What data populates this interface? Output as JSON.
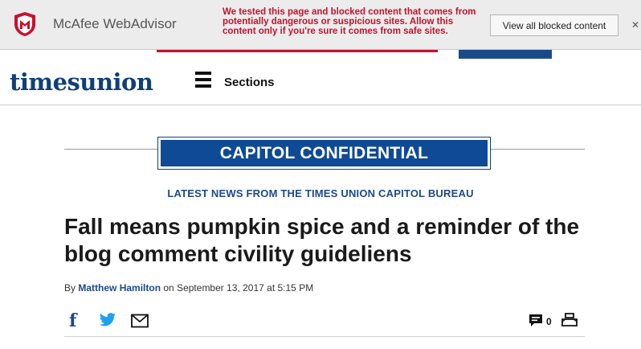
{
  "mcafee": {
    "name": "McAfee WebAdvisor",
    "message": "We tested this page and blocked content that comes from potentially dangerous or suspicious sites. Allow this content only if you're sure it comes from safe sites.",
    "view_button": "View all blocked content",
    "close_glyph": "✕",
    "brand_color": "#c8102e"
  },
  "header": {
    "logo": "timesunion",
    "sections_label": "Sections",
    "icons": [
      "menu-icon"
    ]
  },
  "blog": {
    "name": "CAPITOL CONFIDENTIAL",
    "subtitle": "LATEST NEWS FROM THE TIMES UNION CAPITOL BUREAU",
    "accent_color": "#0f4a96"
  },
  "article": {
    "headline": "Fall means pumpkin spice and a reminder of the blog comment civility guideliens",
    "byline_prefix": "By",
    "author": "Matthew Hamilton",
    "byline_on": "on",
    "date": "September 13, 2017 at 5:15 PM",
    "comment_count": "0",
    "share_icons": [
      "facebook-icon",
      "twitter-icon",
      "email-icon",
      "comment-icon",
      "print-icon"
    ]
  }
}
